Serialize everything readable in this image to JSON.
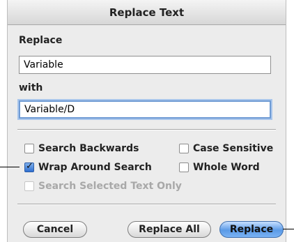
{
  "window": {
    "title": "Replace Text"
  },
  "replace": {
    "label": "Replace",
    "value": "Variable"
  },
  "with": {
    "label": "with",
    "value": "Variable/D"
  },
  "options": {
    "search_backwards": {
      "label": "Search Backwards",
      "checked": false,
      "enabled": true
    },
    "case_sensitive": {
      "label": "Case Sensitive",
      "checked": false,
      "enabled": true
    },
    "wrap_around": {
      "label": "Wrap Around Search",
      "checked": true,
      "enabled": true
    },
    "whole_word": {
      "label": "Whole Word",
      "checked": false,
      "enabled": true
    },
    "selected_only": {
      "label": "Search Selected Text Only",
      "checked": false,
      "enabled": false
    }
  },
  "buttons": {
    "cancel": "Cancel",
    "replace_all": "Replace All",
    "replace": "Replace"
  }
}
